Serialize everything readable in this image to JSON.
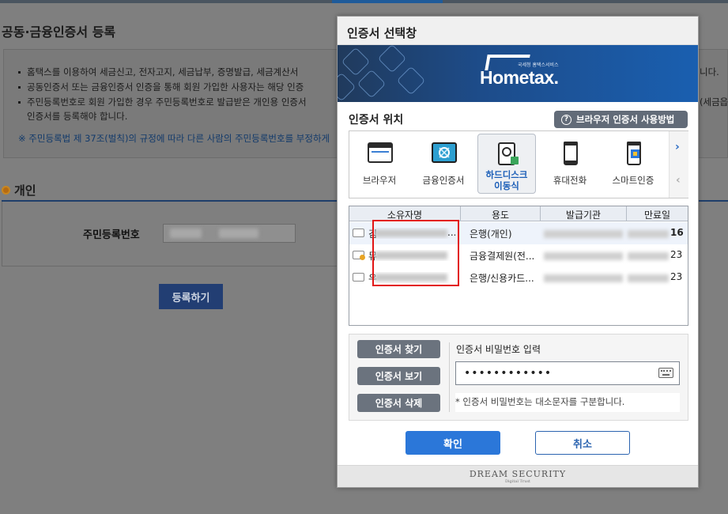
{
  "background": {
    "page_title": "공동·금융인증서 등록",
    "notice_lines": [
      "홈택스를 이용하여 세금신고, 전자고지, 세금납부, 증명발급, 세금계산서 ",
      "공동인증서 또는 금융인증서 인증을 통해 회원 가입한 사용자는 해당 인증",
      "주민등록번호로 회원 가입한 경우 주민등록번호로 발급받은 개인용 인증서",
      "인증서를 등록해야 합니다."
    ],
    "notice_line1_end": "니다.",
    "notice_line3_end": "(세금읍",
    "notice_warning": "※ 주민등록법 제 37조(벌칙)의 규정에 따라 다른 사람의 주민등록번호를 부정하게",
    "section_title": "개인",
    "rrn_label": "주민등록번호",
    "register_button": "등록하기"
  },
  "dialog": {
    "title": "인증서 선택창",
    "banner": {
      "logo_text": "Hometax.",
      "logo_subtext": "국세청 홈택스서비스"
    },
    "location_label": "인증서 위치",
    "help_button": "브라우저 인증서 사용방법",
    "locations": [
      {
        "label": "브라우저",
        "icon": "browser-icon",
        "selected": false
      },
      {
        "label": "금융인증서",
        "icon": "financial-cert-icon",
        "selected": false
      },
      {
        "label": "하드디스크 이동식",
        "line1": "하드디스크",
        "line2": "이동식",
        "icon": "hard-disk-icon",
        "selected": true
      },
      {
        "label": "휴대전화",
        "icon": "mobile-phone-icon",
        "selected": false
      },
      {
        "label": "스마트인증",
        "icon": "smart-cert-icon",
        "selected": false
      }
    ],
    "table": {
      "headers": [
        "소유자명",
        "용도",
        "발급기관",
        "만료일"
      ],
      "rows": [
        {
          "owner_first": "김",
          "owner_tail": "...",
          "usage": "은행(개인)",
          "expiry_tail": "16",
          "selected": true
        },
        {
          "owner_first": "뮤",
          "owner_tail": "",
          "usage": "금융결제원(전...",
          "expiry_tail": "23",
          "selected": false
        },
        {
          "owner_first": "우",
          "owner_tail": "",
          "usage": "은행/신용카드...",
          "expiry_tail": "23",
          "selected": false
        }
      ]
    },
    "buttons": {
      "find": "인증서 찾기",
      "view": "인증서 보기",
      "delete": "인증서 삭제",
      "ok": "확인",
      "cancel": "취소"
    },
    "password": {
      "label": "인증서 비밀번호 입력",
      "value": "••••••••••••",
      "note": "* 인증서 비밀번호는 대소문자를 구분합니다."
    },
    "footer": {
      "brand": "DREAM SECURITY",
      "tagline": "Digital Trust"
    }
  },
  "colors": {
    "primary": "#2b77d9",
    "highlight_box": "#e21414",
    "selected_location_text": "#1c5fb8"
  }
}
